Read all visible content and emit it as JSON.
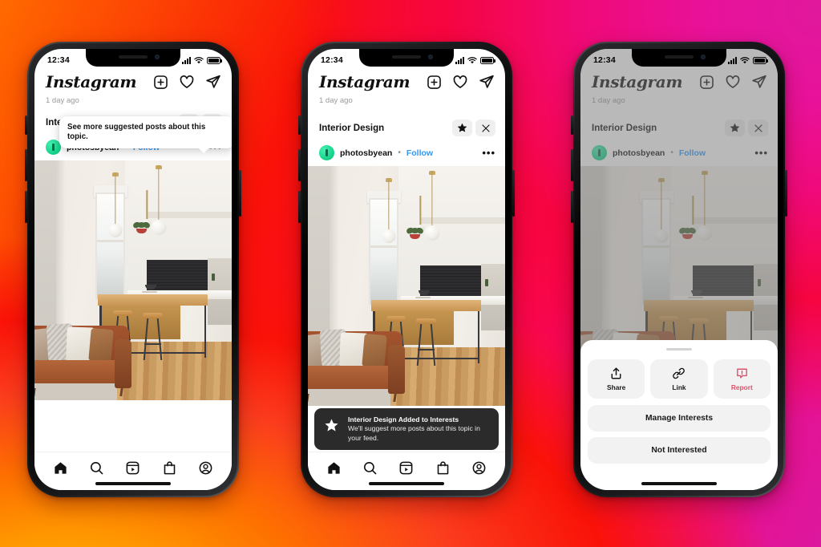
{
  "background": {
    "gradient_colors": [
      "#ffb300",
      "#ff6a00",
      "#fa1208",
      "#f00a7a",
      "#dc189f"
    ]
  },
  "phones": [
    {
      "id": "phone-tooltip",
      "status_bar": {
        "time": "12:34",
        "signal_icon": "signal-bars-icon",
        "wifi_icon": "wifi-icon",
        "battery_icon": "battery-icon"
      },
      "header": {
        "logo": "Instagram",
        "actions": [
          {
            "name": "new-post-icon",
            "label": "New post"
          },
          {
            "name": "activity-heart-icon",
            "label": "Activity"
          },
          {
            "name": "direct-messages-icon",
            "label": "Messages"
          }
        ]
      },
      "meta_time": "1 day ago",
      "tooltip": {
        "text": "See more suggested posts about this topic.",
        "visible": true
      },
      "interest": {
        "title": "Interior Design",
        "star_icon": "star-outline-icon",
        "star_state": "outline",
        "close_icon": "close-x-icon"
      },
      "post": {
        "avatar": "user-avatar",
        "username": "photosbyean",
        "separator": "•",
        "follow_label": "Follow",
        "more_icon": "more-options-icon",
        "image_alt": "interior-design-living-room-photo"
      },
      "bottom_nav": [
        {
          "name": "nav-home-icon",
          "label": "Home",
          "active": true
        },
        {
          "name": "nav-search-icon",
          "label": "Search",
          "active": false
        },
        {
          "name": "nav-reels-icon",
          "label": "Reels",
          "active": false
        },
        {
          "name": "nav-shop-icon",
          "label": "Shop",
          "active": false
        },
        {
          "name": "nav-profile-icon",
          "label": "Profile",
          "active": false
        }
      ]
    },
    {
      "id": "phone-toast",
      "status_bar": {
        "time": "12:34",
        "signal_icon": "signal-bars-icon",
        "wifi_icon": "wifi-icon",
        "battery_icon": "battery-icon"
      },
      "header": {
        "logo": "Instagram",
        "actions": [
          {
            "name": "new-post-icon",
            "label": "New post"
          },
          {
            "name": "activity-heart-icon",
            "label": "Activity"
          },
          {
            "name": "direct-messages-icon",
            "label": "Messages"
          }
        ]
      },
      "meta_time": "1 day ago",
      "interest": {
        "title": "Interior Design",
        "star_icon": "star-filled-icon",
        "star_state": "filled",
        "close_icon": "close-x-icon"
      },
      "post": {
        "avatar": "user-avatar",
        "username": "photosbyean",
        "separator": "•",
        "follow_label": "Follow",
        "more_icon": "more-options-icon",
        "image_alt": "interior-design-living-room-photo"
      },
      "toast": {
        "icon": "star-filled-icon",
        "title": "Interior Design Added to Interests",
        "body": "We'll suggest more posts about this topic in your feed."
      },
      "bottom_nav": [
        {
          "name": "nav-home-icon",
          "label": "Home",
          "active": true
        },
        {
          "name": "nav-search-icon",
          "label": "Search",
          "active": false
        },
        {
          "name": "nav-reels-icon",
          "label": "Reels",
          "active": false
        },
        {
          "name": "nav-shop-icon",
          "label": "Shop",
          "active": false
        },
        {
          "name": "nav-profile-icon",
          "label": "Profile",
          "active": false
        }
      ]
    },
    {
      "id": "phone-action-sheet",
      "status_bar": {
        "time": "12:34",
        "signal_icon": "signal-bars-icon",
        "wifi_icon": "wifi-icon",
        "battery_icon": "battery-icon"
      },
      "header": {
        "logo": "Instagram",
        "actions": [
          {
            "name": "new-post-icon",
            "label": "New post"
          },
          {
            "name": "activity-heart-icon",
            "label": "Activity"
          },
          {
            "name": "direct-messages-icon",
            "label": "Messages"
          }
        ]
      },
      "meta_time": "1 day ago",
      "interest": {
        "title": "Interior Design",
        "star_icon": "star-filled-icon",
        "star_state": "filled",
        "close_icon": "close-x-icon"
      },
      "post": {
        "avatar": "user-avatar",
        "username": "photosbyean",
        "separator": "•",
        "follow_label": "Follow",
        "more_icon": "more-options-icon",
        "image_alt": "interior-design-living-room-photo"
      },
      "action_sheet": {
        "handle": "drag-handle",
        "tiles": [
          {
            "name": "share-tile",
            "label": "Share",
            "icon": "share-upload-icon",
            "danger": false
          },
          {
            "name": "link-tile",
            "label": "Link",
            "icon": "link-chain-icon",
            "danger": false
          },
          {
            "name": "report-tile",
            "label": "Report",
            "icon": "report-warning-icon",
            "danger": true
          }
        ],
        "rows": [
          {
            "name": "manage-interests-button",
            "label": "Manage Interests"
          },
          {
            "name": "not-interested-button",
            "label": "Not Interested"
          }
        ],
        "danger_color": "#e0516b"
      }
    }
  ]
}
